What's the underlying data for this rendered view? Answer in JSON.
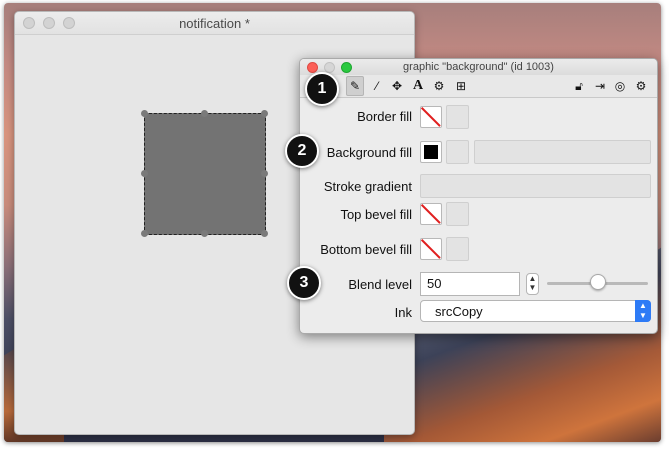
{
  "document_window": {
    "title": "notification *"
  },
  "inspector": {
    "title": "graphic \"background\" (id 1003)",
    "toolbar_icons": [
      "pencil-icon",
      "magic-wand-icon",
      "move-icon",
      "text-icon",
      "gears-icon",
      "resize-icon",
      "lock-icon",
      "export-icon",
      "target-icon",
      "settings-icon"
    ],
    "rows": {
      "border_fill": "Border fill",
      "background_fill": "Background fill",
      "stroke_gradient": "Stroke gradient",
      "top_bevel_fill": "Top bevel fill",
      "bottom_bevel_fill": "Bottom bevel fill",
      "blend_level": "Blend level",
      "ink": "Ink"
    },
    "blend_level_value": "50",
    "ink_value": "srcCopy",
    "blend_slider_level": 0.5
  },
  "callouts": [
    "1",
    "2",
    "3"
  ],
  "colors": {
    "accent": "#2e7bf6",
    "close": "#fc5f57",
    "zoom": "#2ac940",
    "shape": "#737373"
  }
}
